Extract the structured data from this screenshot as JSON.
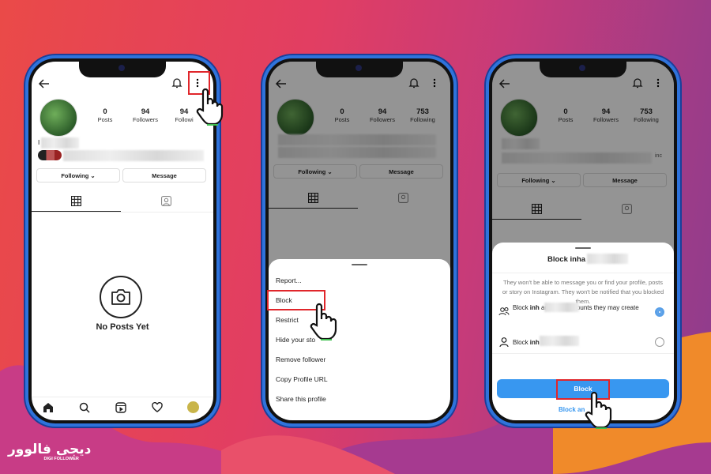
{
  "colors": {
    "accent": "#3897f0",
    "frame": "#2f73db",
    "highlight": "#e0262b"
  },
  "profile": {
    "posts_count": "0",
    "posts_label": "Posts",
    "followers_count": "94",
    "followers_label": "Followers",
    "following_count_partial": "94",
    "following_label_partial": "Followi",
    "following_count": "753",
    "following_label": "Following",
    "following_button": "Following ⌄",
    "message_button": "Message",
    "name_initial": "I",
    "no_posts": "No Posts Yet",
    "mutual_suffix": "inc"
  },
  "menu": {
    "items": [
      "Report...",
      "Block",
      "Restrict",
      "Hide your sto",
      "Remove follower",
      "Copy Profile URL",
      "Share this profile"
    ]
  },
  "block_dialog": {
    "title": "Block inha",
    "description": "They won't be able to message you or find your profile, posts or story on Instagram. They won't be notified that you blocked them.",
    "option1_prefix": "Block ",
    "option1_name": "inh",
    "option1_suffix": " and new accounts they may create",
    "option1_selected": true,
    "option2_prefix": "Block ",
    "option2_name": "inh",
    "block_button": "Block",
    "block_and_report": "Block an"
  },
  "icons": [
    "back-arrow-icon",
    "bell-icon",
    "more-vertical-icon",
    "grid-icon",
    "tagged-icon",
    "camera-icon",
    "home-icon",
    "search-icon",
    "reels-icon",
    "heart-icon",
    "profile-icon",
    "hand-pointer-icon",
    "people-icon",
    "person-icon"
  ],
  "brand": {
    "logo_text": "دیجی فالوور",
    "logo_sub": "DIGI FOLLOWER"
  }
}
